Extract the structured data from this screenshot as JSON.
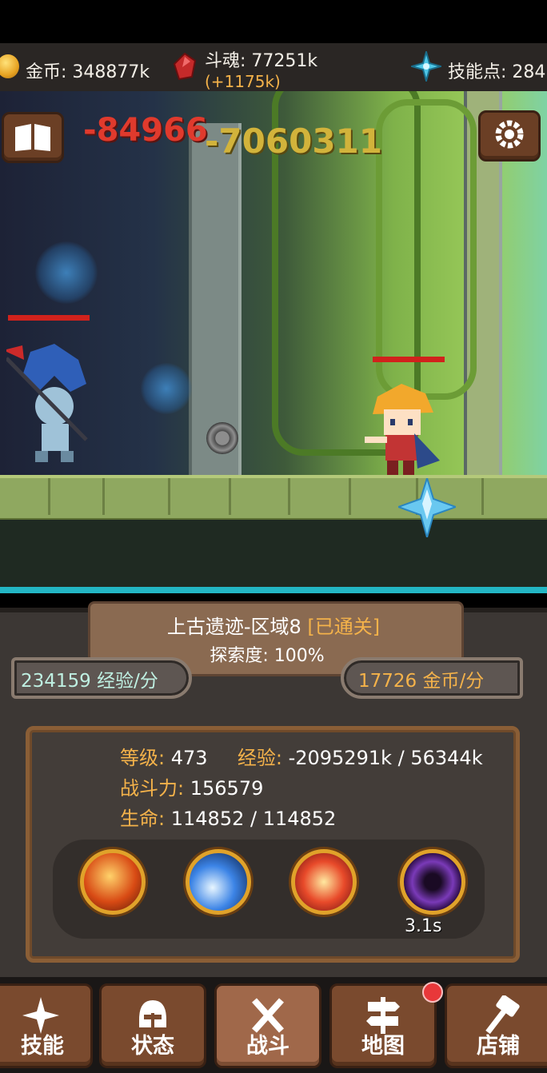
{
  "resources": {
    "gold_label": "金币: 348877k",
    "soul_label": "斗魂: 77251k",
    "soul_gain": "(+1175k)",
    "skill_points_label": "技能点: 284"
  },
  "battle": {
    "damage_red": "-84966",
    "damage_gold": "-7060311"
  },
  "area": {
    "name": "上古遗迹-区域8",
    "cleared": "[已通关]",
    "exploration": "探索度:  100%"
  },
  "rates": {
    "exp": "234159  经验/分",
    "gold": "17726  金币/分"
  },
  "stats": {
    "level_key": "等级:",
    "level_val": "473",
    "exp_key": "经验:",
    "exp_val": "-2095291k / 56344k",
    "power_key": "战斗力:",
    "power_val": "156579",
    "hp_key": "生命:",
    "hp_val": "114852 / 114852"
  },
  "skills": {
    "cooldown": "3.1s"
  },
  "nav": {
    "tabs": [
      {
        "label": "技能"
      },
      {
        "label": "状态"
      },
      {
        "label": "战斗"
      },
      {
        "label": "地图"
      },
      {
        "label": "店铺"
      }
    ]
  }
}
